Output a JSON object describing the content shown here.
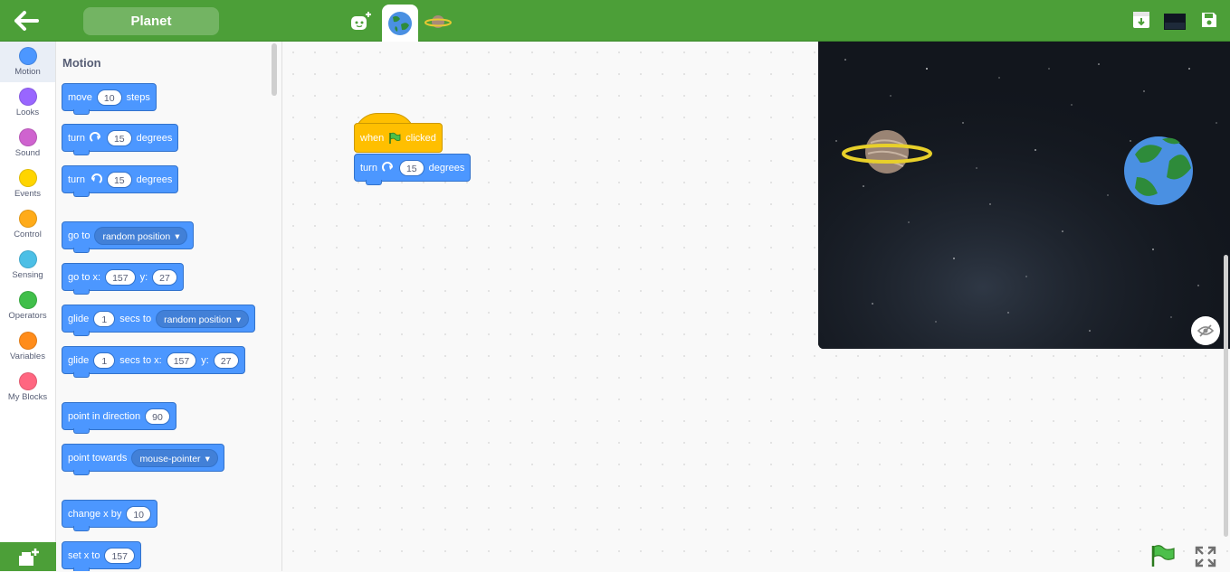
{
  "header": {
    "project_title": "Planet",
    "accent_color": "#4c9f38",
    "sprites": [
      "add-sprite-icon",
      "earth-sprite",
      "planet-sprite"
    ],
    "right_icons": [
      "save-to-device-icon",
      "stage-thumbnail",
      "save-icon"
    ]
  },
  "categories": [
    {
      "label": "Motion",
      "color": "#4c97ff"
    },
    {
      "label": "Looks",
      "color": "#9966ff"
    },
    {
      "label": "Sound",
      "color": "#cf63cf"
    },
    {
      "label": "Events",
      "color": "#ffd500"
    },
    {
      "label": "Control",
      "color": "#ffab19"
    },
    {
      "label": "Sensing",
      "color": "#4cbfe6"
    },
    {
      "label": "Operators",
      "color": "#40bf4a"
    },
    {
      "label": "Variables",
      "color": "#ff8c1a"
    },
    {
      "label": "My Blocks",
      "color": "#ff6680"
    }
  ],
  "palette": {
    "title": "Motion",
    "move": {
      "a": "move",
      "n": "10",
      "b": "steps"
    },
    "turn_right": {
      "a": "turn",
      "n": "15",
      "b": "degrees"
    },
    "turn_left": {
      "a": "turn",
      "n": "15",
      "b": "degrees"
    },
    "goto": {
      "a": "go to",
      "dd": "random position"
    },
    "goto_xy": {
      "a": "go to x:",
      "x": "157",
      "b": "y:",
      "y": "27"
    },
    "glide_to": {
      "a": "glide",
      "n": "1",
      "b": "secs to",
      "dd": "random position"
    },
    "glide_xy": {
      "a": "glide",
      "n": "1",
      "b": "secs to x:",
      "x": "157",
      "c": "y:",
      "y": "27"
    },
    "point_dir": {
      "a": "point in direction",
      "n": "90"
    },
    "point_towards": {
      "a": "point towards",
      "dd": "mouse-pointer"
    },
    "change_x": {
      "a": "change x by",
      "n": "10"
    },
    "set_x": {
      "a": "set x to",
      "n": "157"
    }
  },
  "script": {
    "hat": {
      "a": "when",
      "b": "clicked"
    },
    "turn": {
      "a": "turn",
      "n": "15",
      "b": "degrees"
    }
  }
}
